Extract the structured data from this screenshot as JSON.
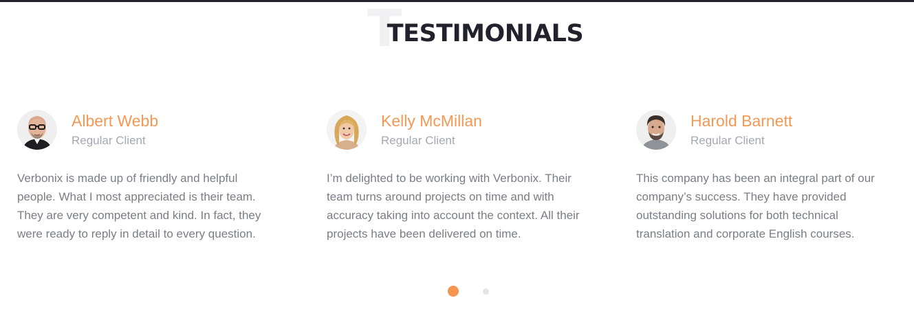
{
  "section": {
    "ghost_letter": "T",
    "title": "TESTIMONIALS"
  },
  "colors": {
    "accent": "#f29a55",
    "heading": "#22222c",
    "muted": "#a5a8b2",
    "body_text": "#7a7d86"
  },
  "testimonials": [
    {
      "name": "Albert Webb",
      "role": "Regular Client",
      "quote": "Verbonix is made up of friendly and helpful people. What I most appreciated is their team. They are very competent and kind. In fact, they were ready to reply in detail to every question.",
      "avatar_icon": "bald-man-with-glasses-avatar"
    },
    {
      "name": "Kelly McMillan",
      "role": "Regular Client",
      "quote": "I’m delighted to be working with Verbonix. Their team turns around projects on time and with accuracy taking into account the context. All their projects have been delivered on time.",
      "avatar_icon": "blonde-woman-avatar"
    },
    {
      "name": "Harold Barnett",
      "role": "Regular Client",
      "quote": "This company has been an integral part of our company’s success. They have provided outstanding solutions for both technical translation and corporate English courses.",
      "avatar_icon": "bearded-man-avatar"
    }
  ],
  "pagination": {
    "pages": 2,
    "active": 1
  }
}
